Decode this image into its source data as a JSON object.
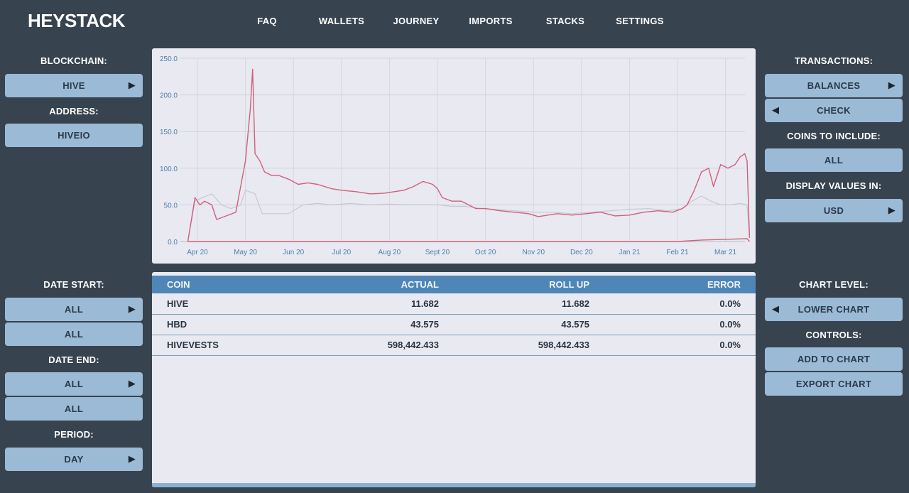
{
  "app": {
    "logo": "HEYSTACK"
  },
  "nav": [
    "FAQ",
    "WALLETS",
    "JOURNEY",
    "IMPORTS",
    "STACKS",
    "SETTINGS"
  ],
  "left": {
    "blockchain_label": "BLOCKCHAIN:",
    "blockchain_value": "HIVE",
    "address_label": "ADDRESS:",
    "address_value": "HIVEIO",
    "date_start_label": "DATE START:",
    "date_start_value": "ALL",
    "date_start_sub": "ALL",
    "date_end_label": "DATE END:",
    "date_end_value": "ALL",
    "date_end_sub": "ALL",
    "period_label": "PERIOD:",
    "period_value": "DAY"
  },
  "right": {
    "transactions_label": "TRANSACTIONS:",
    "balances": "BALANCES",
    "check": "CHECK",
    "coins_label": "COINS TO INCLUDE:",
    "coins_value": "ALL",
    "display_label": "DISPLAY VALUES IN:",
    "display_value": "USD",
    "chart_level_label": "CHART LEVEL:",
    "chart_level_value": "LOWER CHART",
    "controls_label": "CONTROLS:",
    "add_to_chart": "ADD TO CHART",
    "export_chart": "EXPORT CHART"
  },
  "colors": {
    "background": "#37434f",
    "button": "#9bbad6",
    "panel": "#e8e9f1",
    "table_header": "#4f86b8",
    "series_primary": "#d1607a",
    "series_secondary": "#c8c8d2"
  },
  "table": {
    "headers": [
      "COIN",
      "ACTUAL",
      "ROLL UP",
      "ERROR"
    ],
    "rows": [
      [
        "HIVE",
        "11.682",
        "11.682",
        "0.0%"
      ],
      [
        "HBD",
        "43.575",
        "43.575",
        "0.0%"
      ],
      [
        "HIVEVESTS",
        "598,442.433",
        "598,442.433",
        "0.0%"
      ]
    ]
  },
  "chart_data": {
    "type": "line",
    "ylim": [
      0,
      250
    ],
    "y_ticks": [
      "0.0",
      "50.0",
      "100.0",
      "150.0",
      "200.0",
      "250.0"
    ],
    "x_ticks": [
      "Apr 20",
      "May 20",
      "Jun 20",
      "Jul 20",
      "Aug 20",
      "Sept 20",
      "Oct 20",
      "Nov 20",
      "Dec 20",
      "Jan 21",
      "Feb 21",
      "Mar 21"
    ],
    "x_range": [
      0,
      11.6
    ],
    "series": [
      {
        "color": "#d1607a",
        "points": [
          [
            -0.2,
            0
          ],
          [
            -0.05,
            60
          ],
          [
            0.05,
            50
          ],
          [
            0.15,
            55
          ],
          [
            0.3,
            50
          ],
          [
            0.4,
            30
          ],
          [
            0.6,
            35
          ],
          [
            0.8,
            40
          ],
          [
            1.0,
            110
          ],
          [
            1.1,
            180
          ],
          [
            1.15,
            235
          ],
          [
            1.2,
            120
          ],
          [
            1.3,
            110
          ],
          [
            1.4,
            95
          ],
          [
            1.55,
            90
          ],
          [
            1.7,
            90
          ],
          [
            1.9,
            85
          ],
          [
            2.1,
            78
          ],
          [
            2.3,
            80
          ],
          [
            2.5,
            78
          ],
          [
            2.8,
            72
          ],
          [
            3.0,
            70
          ],
          [
            3.3,
            68
          ],
          [
            3.6,
            65
          ],
          [
            3.9,
            66
          ],
          [
            4.1,
            68
          ],
          [
            4.3,
            70
          ],
          [
            4.5,
            75
          ],
          [
            4.7,
            82
          ],
          [
            4.9,
            78
          ],
          [
            5.0,
            72
          ],
          [
            5.1,
            60
          ],
          [
            5.3,
            55
          ],
          [
            5.5,
            55
          ],
          [
            5.8,
            45
          ],
          [
            6.0,
            45
          ],
          [
            6.3,
            42
          ],
          [
            6.6,
            40
          ],
          [
            6.9,
            38
          ],
          [
            7.1,
            34
          ],
          [
            7.3,
            36
          ],
          [
            7.5,
            38
          ],
          [
            7.8,
            36
          ],
          [
            8.1,
            38
          ],
          [
            8.4,
            40
          ],
          [
            8.7,
            35
          ],
          [
            9.0,
            36
          ],
          [
            9.3,
            40
          ],
          [
            9.6,
            42
          ],
          [
            9.9,
            40
          ],
          [
            10.1,
            45
          ],
          [
            10.2,
            50
          ],
          [
            10.35,
            70
          ],
          [
            10.5,
            95
          ],
          [
            10.65,
            100
          ],
          [
            10.75,
            75
          ],
          [
            10.9,
            105
          ],
          [
            11.05,
            100
          ],
          [
            11.2,
            105
          ],
          [
            11.3,
            115
          ],
          [
            11.4,
            120
          ],
          [
            11.45,
            110
          ],
          [
            11.5,
            5
          ]
        ]
      },
      {
        "color": "#c8c8d2",
        "points": [
          [
            -0.2,
            0
          ],
          [
            -0.05,
            55
          ],
          [
            0.1,
            60
          ],
          [
            0.3,
            65
          ],
          [
            0.5,
            50
          ],
          [
            0.7,
            45
          ],
          [
            0.9,
            50
          ],
          [
            1.0,
            70
          ],
          [
            1.2,
            65
          ],
          [
            1.35,
            38
          ],
          [
            1.6,
            38
          ],
          [
            1.9,
            38
          ],
          [
            2.2,
            50
          ],
          [
            2.5,
            52
          ],
          [
            2.8,
            50
          ],
          [
            3.2,
            52
          ],
          [
            3.6,
            50
          ],
          [
            4.0,
            51
          ],
          [
            4.4,
            50
          ],
          [
            4.8,
            50
          ],
          [
            5.0,
            50
          ],
          [
            5.3,
            48
          ],
          [
            5.6,
            48
          ],
          [
            5.9,
            45
          ],
          [
            6.2,
            44
          ],
          [
            6.6,
            42
          ],
          [
            7.0,
            40
          ],
          [
            7.4,
            40
          ],
          [
            7.8,
            38
          ],
          [
            8.2,
            40
          ],
          [
            8.6,
            42
          ],
          [
            9.0,
            44
          ],
          [
            9.4,
            45
          ],
          [
            9.8,
            42
          ],
          [
            10.1,
            45
          ],
          [
            10.3,
            55
          ],
          [
            10.5,
            62
          ],
          [
            10.7,
            55
          ],
          [
            10.9,
            50
          ],
          [
            11.1,
            50
          ],
          [
            11.3,
            52
          ],
          [
            11.45,
            50
          ],
          [
            11.5,
            5
          ]
        ]
      },
      {
        "color": "#d1607a",
        "points": [
          [
            -0.2,
            0
          ],
          [
            10.0,
            0
          ],
          [
            10.5,
            2
          ],
          [
            11.0,
            3
          ],
          [
            11.45,
            4
          ],
          [
            11.5,
            0
          ]
        ]
      }
    ]
  }
}
